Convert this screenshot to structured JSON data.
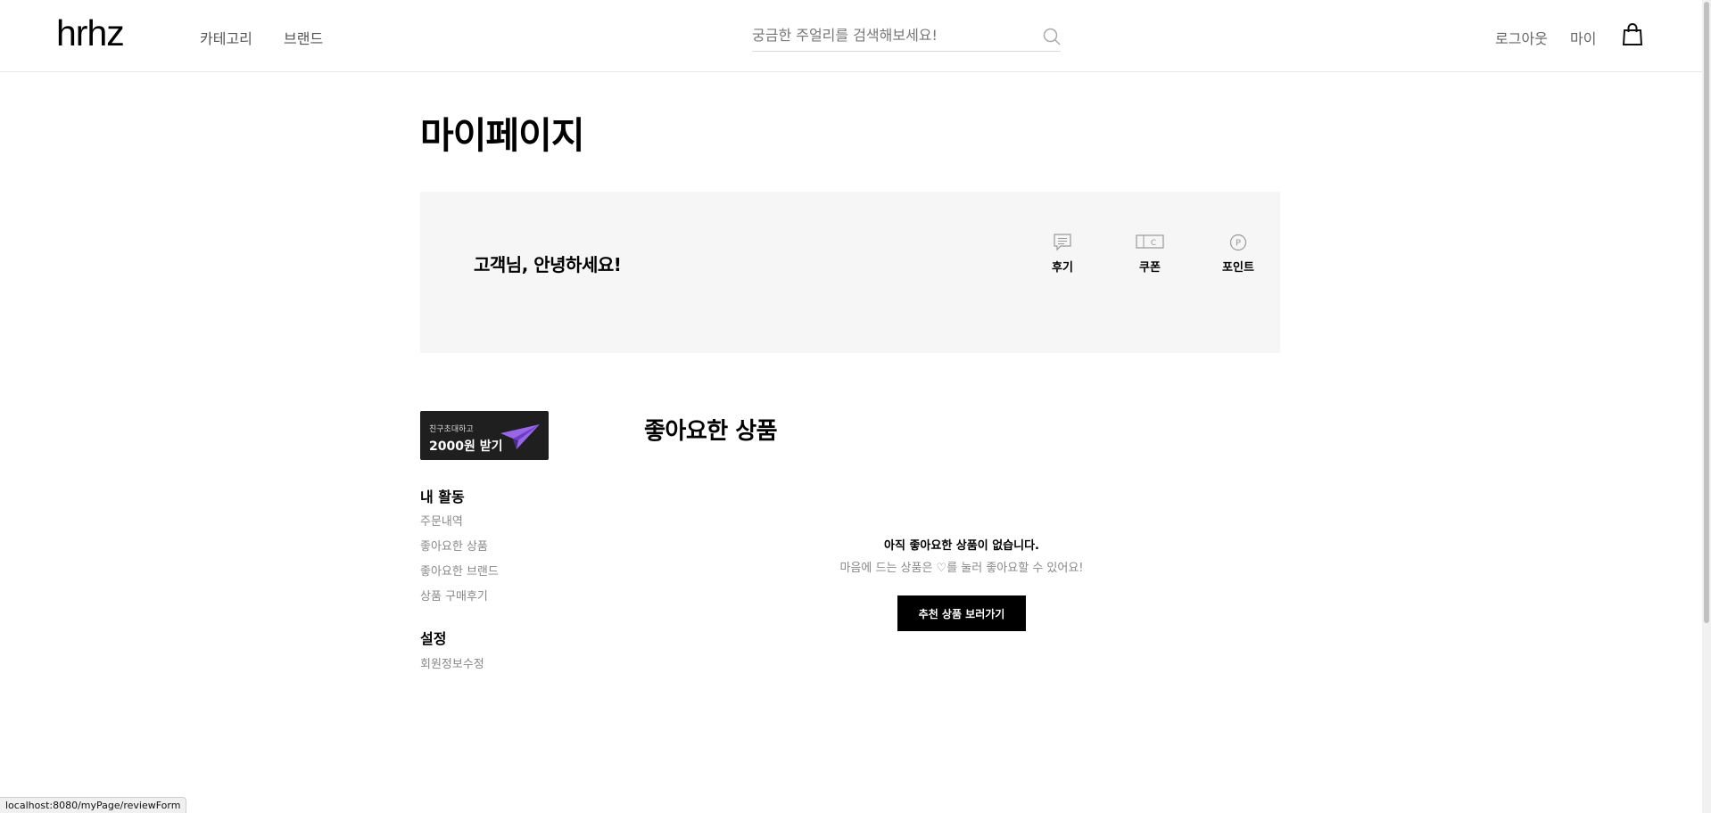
{
  "header": {
    "logo": "hrhz",
    "nav": [
      "카테고리",
      "브랜드"
    ],
    "search_placeholder": "궁금한 주얼리를 검색해보세요!",
    "right_links": [
      "로그아웃",
      "마이"
    ]
  },
  "page": {
    "title": "마이페이지"
  },
  "profile": {
    "greeting": "고객님, 안녕하세요!",
    "stats": [
      {
        "label": "후기",
        "icon": "review-icon"
      },
      {
        "label": "쿠폰",
        "icon": "coupon-icon"
      },
      {
        "label": "포인트",
        "icon": "point-icon"
      }
    ]
  },
  "invite_banner": {
    "small": "친구초대하고",
    "big": "2000원 받기",
    "icon": "paper-plane-icon"
  },
  "sidebar": {
    "activity_heading": "내 활동",
    "activity_items": [
      "주문내역",
      "좋아요한 상품",
      "좋아요한 브랜드",
      "상품 구매후기"
    ],
    "settings_heading": "설정",
    "settings_items": [
      "회원정보수정"
    ]
  },
  "main": {
    "section_title": "좋아요한 상품",
    "empty_title": "아직 좋아요한 상품이 없습니다.",
    "empty_sub": "마음에 드는 상품은 ♡를 눌러 좋아요할 수 있어요!",
    "cta_label": "추천 상품 보러가기"
  },
  "status_bar": {
    "url": "localhost:8080/myPage/reviewForm"
  }
}
